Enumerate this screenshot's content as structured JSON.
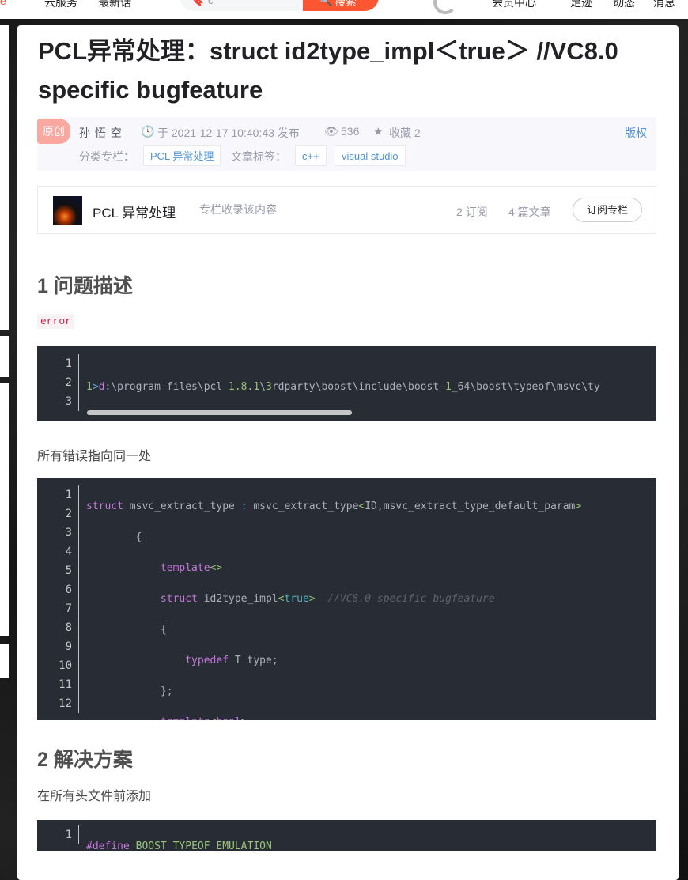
{
  "topbar": {
    "left_fragment": "e",
    "nav1": "云服务",
    "nav2": "最新话",
    "search_placeholder": "c",
    "search_button": "搜索",
    "right1": "会员中心",
    "right2": "足迹",
    "right3": "动态",
    "right4": "消息"
  },
  "article": {
    "title": "PCL异常处理：struct id2type_impl＜true＞ //VC8.0 specific bugfeature",
    "badge": "原创",
    "author": "孙 悟 空",
    "publish": "于 2021-12-17 10:40:43 发布",
    "views": "536",
    "favorites": "收藏 2",
    "copyright": "版权",
    "category_label": "分类专栏：",
    "category": "PCL 异常处理",
    "tags_label": "文章标签：",
    "tags": [
      "c++",
      "visual studio"
    ]
  },
  "column": {
    "name": "PCL 异常处理",
    "subtitle": "专栏收录该内容",
    "subscriptions": "2 订阅",
    "articles": "4 篇文章",
    "subscribe_button": "订阅专栏"
  },
  "section1": {
    "heading": "1 问题描述",
    "inline_code": "error",
    "code_line_numbers": [
      "1",
      "2",
      "3"
    ],
    "code_lines": [
      "1>d:\\program files\\pcl 1.8.1\\3rdparty\\boost\\include\\boost-1_64\\boost\\typeof\\msvc\\ty",
      "1>d:\\program files\\pcl 1.8.1\\3rdparty\\boost\\include\\boost-1_64\\boost\\typeof\\msvc\\ty",
      "1>d:\\program files\\pcl 1.8.1\\3rdparty\\boost\\include\\boost-1_64\\boost\\typeof\\msvc\\ty"
    ],
    "note": "所有错误指向同一处",
    "code2_line_numbers": [
      "1",
      "2",
      "3",
      "4",
      "5",
      "6",
      "7",
      "8",
      "9",
      "10",
      "11",
      "12"
    ]
  },
  "section2": {
    "heading": "2 解决方案",
    "note": "在所有头文件前添加",
    "code_line_numbers": [
      "1"
    ]
  },
  "colors": {
    "code_bg": "#282c34",
    "keyword": "#c678dd",
    "number": "#98c379",
    "accent": "#fc5531"
  }
}
